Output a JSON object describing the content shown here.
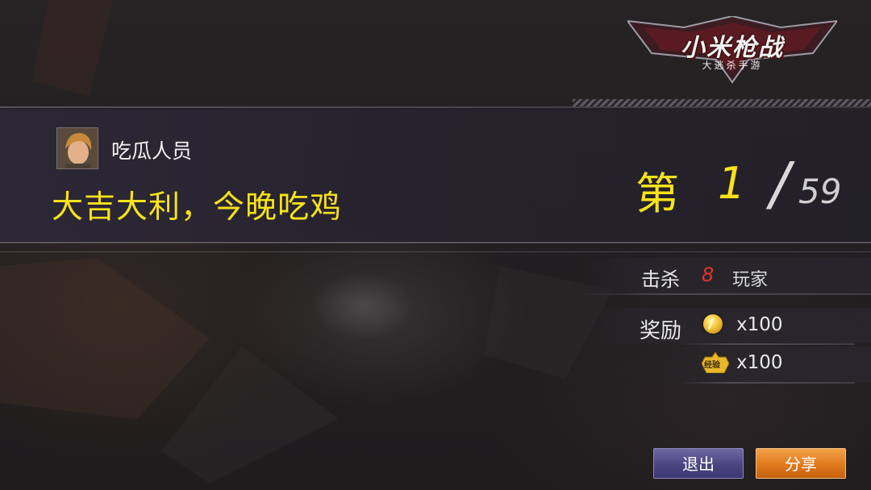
{
  "logo": {
    "title": "小米枪战",
    "subtitle": "大逃杀手游"
  },
  "player": {
    "name": "吃瓜人员",
    "avatar_icon": "player-avatar-portrait"
  },
  "result": {
    "message": "大吉大利，今晚吃鸡",
    "rank_prefix": "第",
    "rank": "1",
    "slash": "/",
    "total_players": "59"
  },
  "stats": {
    "kills_label": "击杀",
    "kills_value": "8",
    "kills_unit": "玩家",
    "reward_label": "奖励",
    "coin_icon": "gold-coin-icon",
    "coin_reward": "x100",
    "exp_icon": "experience-badge-icon",
    "exp_icon_text": "经验",
    "exp_reward": "x100"
  },
  "buttons": {
    "exit_label": "退出",
    "share_label": "分享"
  },
  "colors": {
    "highlight_yellow": "#f7e21a",
    "kill_red": "#e5302a",
    "exit_button": "#4b4682",
    "share_button": "#e07a1d"
  }
}
